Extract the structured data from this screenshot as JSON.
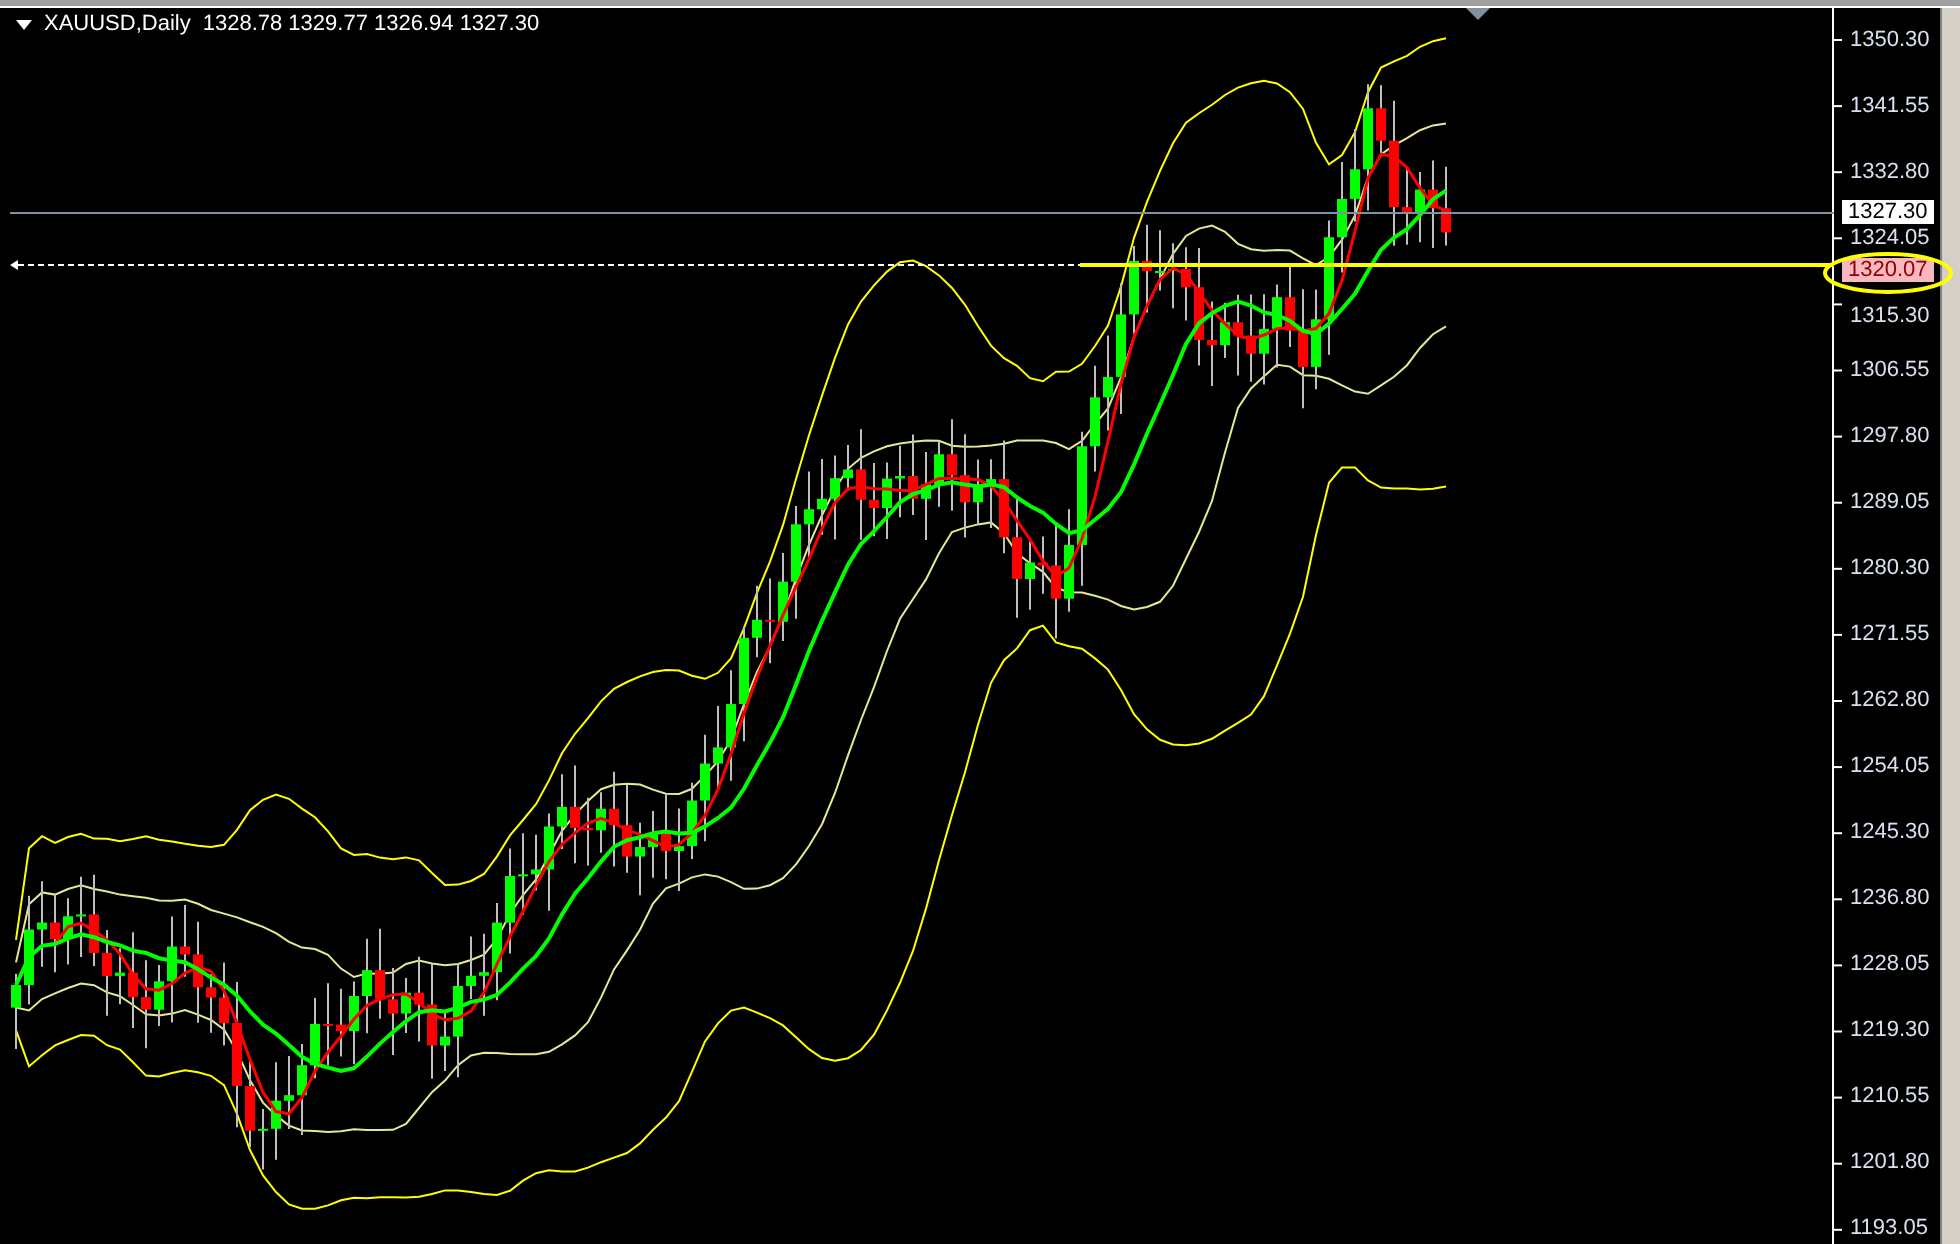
{
  "chart": {
    "symbol": "XAUUSD,Daily",
    "ohlc": "1328.78 1329.77 1326.94 1327.30"
  },
  "price_axis": {
    "labels": [
      "1350.30",
      "1341.55",
      "1332.80",
      "1324.05",
      "1315.30",
      "1306.55",
      "1297.80",
      "1289.05",
      "1280.30",
      "1271.55",
      "1262.80",
      "1254.05",
      "1245.30",
      "1236.80",
      "1228.05",
      "1219.30",
      "1210.55",
      "1201.80",
      "1193.05"
    ]
  },
  "current_price": "1327.30",
  "level_line": {
    "price": "1320.07",
    "highlighted": true,
    "circled": true
  }
}
